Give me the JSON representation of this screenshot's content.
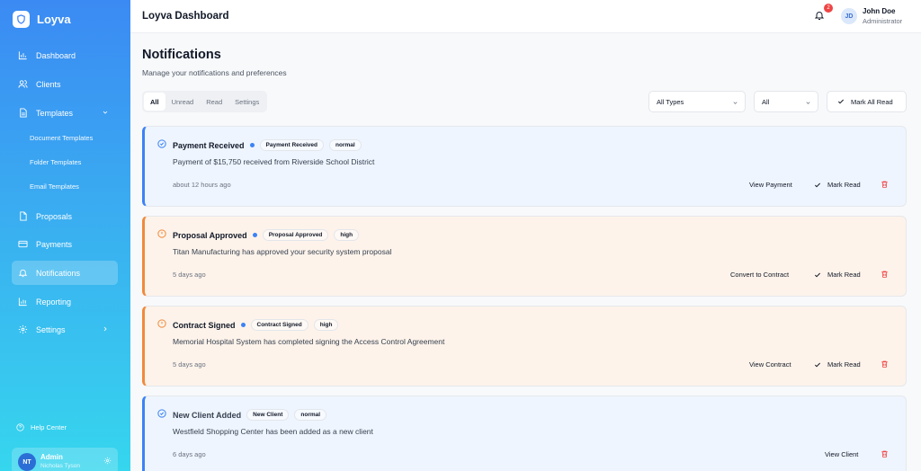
{
  "brand": {
    "name": "Loyva"
  },
  "sidebar": {
    "items": [
      {
        "label": "Dashboard",
        "icon": "chart-icon"
      },
      {
        "label": "Clients",
        "icon": "users-icon"
      },
      {
        "label": "Templates",
        "icon": "document-icon"
      },
      {
        "label": "Proposals",
        "icon": "file-icon"
      },
      {
        "label": "Payments",
        "icon": "card-icon"
      },
      {
        "label": "Notifications",
        "icon": "bell-icon"
      },
      {
        "label": "Reporting",
        "icon": "bar-chart-icon"
      },
      {
        "label": "Settings",
        "icon": "gear-icon"
      }
    ],
    "sub_items": [
      "Document Templates",
      "Folder Templates",
      "Email Templates"
    ],
    "help": "Help Center",
    "user": {
      "initials": "NT",
      "name": "Admin",
      "sub": "Nicholas Tyson"
    }
  },
  "header": {
    "title": "Loyva Dashboard",
    "notification_count": "2",
    "user_initials": "JD",
    "user_name": "John Doe",
    "user_role": "Administrator"
  },
  "main": {
    "title": "Notifications",
    "subtitle": "Manage your notifications and preferences",
    "tabs": [
      "All",
      "Unread",
      "Read",
      "Settings"
    ],
    "filters": {
      "type": "All Types",
      "status": "All"
    },
    "mark_all": "Mark All Read",
    "mark_read": "Mark Read"
  },
  "notifications": [
    {
      "title": "Payment Received",
      "tag": "Payment Received",
      "priority": "normal",
      "message": "Payment of $15,750 received from Riverside School District",
      "time": "about 12 hours ago",
      "action": "View Payment",
      "unread": true
    },
    {
      "title": "Proposal Approved",
      "tag": "Proposal Approved",
      "priority": "high",
      "message": "Titan Manufacturing has approved your security system proposal",
      "time": "5 days ago",
      "action": "Convert to Contract",
      "unread": true
    },
    {
      "title": "Contract Signed",
      "tag": "Contract Signed",
      "priority": "high",
      "message": "Memorial Hospital System has completed signing the Access Control Agreement",
      "time": "5 days ago",
      "action": "View Contract",
      "unread": true
    },
    {
      "title": "New Client Added",
      "tag": "New Client",
      "priority": "normal",
      "message": "Westfield Shopping Center has been added as a new client",
      "time": "6 days ago",
      "action": "View Client",
      "unread": false
    }
  ],
  "colors": {
    "accent": "#3b82f6",
    "warning": "#f08a3c",
    "danger": "#ef4444"
  }
}
